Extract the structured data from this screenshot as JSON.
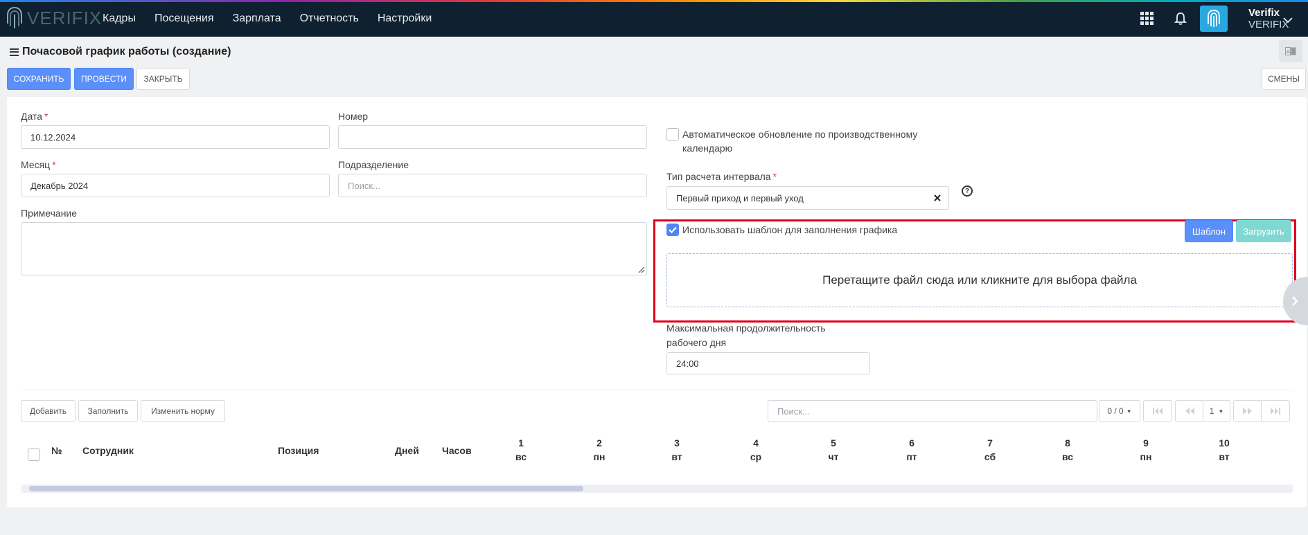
{
  "app": {
    "logo_text": "VERIFIX"
  },
  "nav": {
    "items": [
      "Кадры",
      "Посещения",
      "Зарплата",
      "Отчетность",
      "Настройки"
    ]
  },
  "user": {
    "name": "Verifix",
    "org": "VERIFIX"
  },
  "page": {
    "title": "Почасовой график работы (создание)"
  },
  "toolbar": {
    "save": "СОХРАНИТЬ",
    "post": "ПРОВЕСТИ",
    "close": "ЗАКРЫТЬ",
    "shifts": "СМЕНЫ"
  },
  "form": {
    "date_label": "Дата",
    "date_value": "10.12.2024",
    "number_label": "Номер",
    "number_value": "",
    "month_label": "Месяц",
    "month_value": "Декабрь 2024",
    "division_label": "Подразделение",
    "division_placeholder": "Поиск...",
    "note_label": "Примечание",
    "note_value": "",
    "auto_update_label": "Автоматическое обновление по производственному календарю",
    "auto_update_checked": false,
    "interval_label": "Тип расчета интервала",
    "interval_value": "Первый приход и первый уход",
    "use_template_label": "Использовать шаблон для заполнения графика",
    "use_template_checked": true,
    "template_button": "Шаблон",
    "upload_button": "Загрузить",
    "dropzone_text": "Перетащите файл сюда или кликните для выбора файла",
    "max_duration_label": "Максимальная продолжительность рабочего дня",
    "max_duration_value": "24:00"
  },
  "table_toolbar": {
    "add": "Добавить",
    "fill": "Заполнить",
    "change_norm": "Изменить норму",
    "search_placeholder": "Поиск...",
    "count": "0 / 0",
    "page": "1"
  },
  "table": {
    "columns": {
      "num": "№",
      "employee": "Сотрудник",
      "position": "Позиция",
      "days": "Дней",
      "hours": "Часов"
    },
    "days": [
      {
        "n": "1",
        "w": "вс"
      },
      {
        "n": "2",
        "w": "пн"
      },
      {
        "n": "3",
        "w": "вт"
      },
      {
        "n": "4",
        "w": "ср"
      },
      {
        "n": "5",
        "w": "чт"
      },
      {
        "n": "6",
        "w": "пт"
      },
      {
        "n": "7",
        "w": "сб"
      },
      {
        "n": "8",
        "w": "вс"
      },
      {
        "n": "9",
        "w": "пн"
      },
      {
        "n": "10",
        "w": "вт"
      }
    ]
  },
  "colors": {
    "topbar": "#0f2131",
    "primary": "#5b8ff9",
    "upload": "#7fd8d2",
    "highlight": "#e0001a"
  }
}
